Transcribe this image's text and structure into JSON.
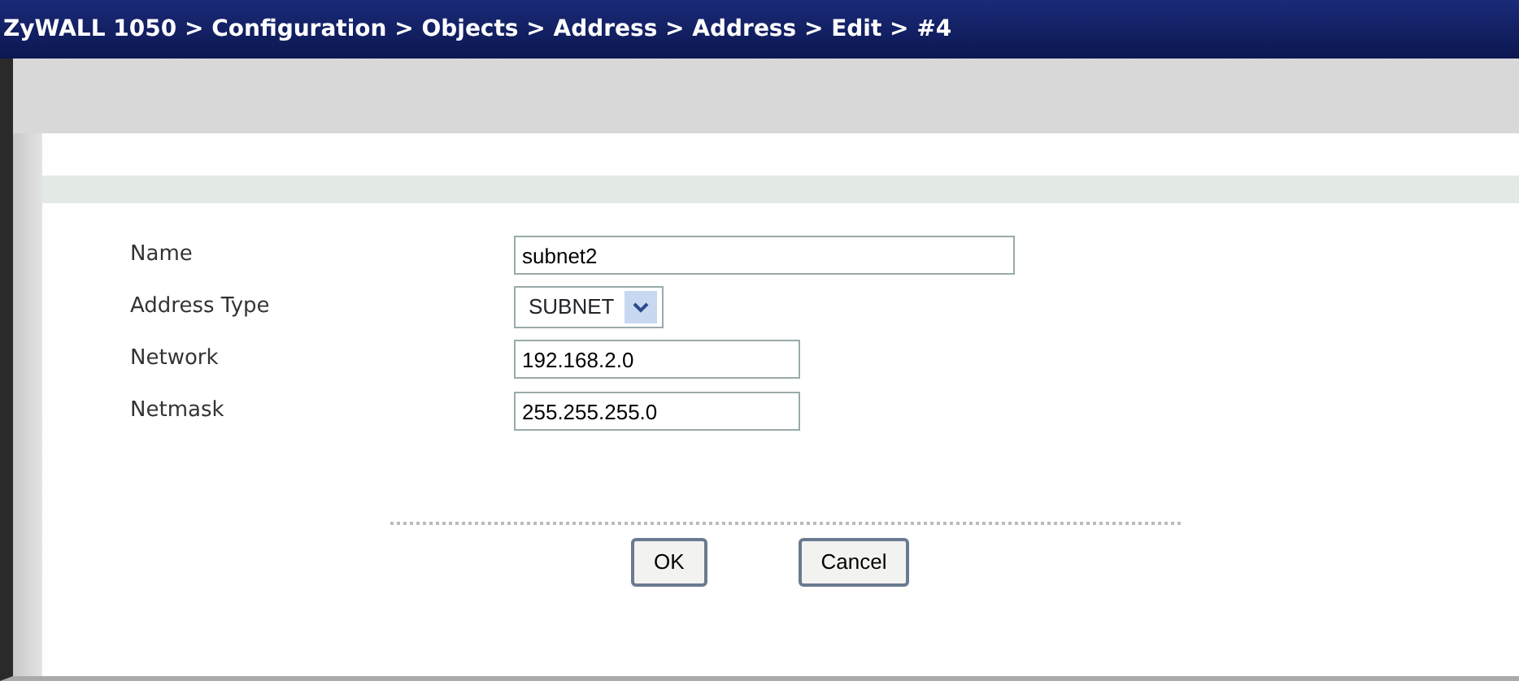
{
  "window": {
    "title": "ZyWALL 1050 > Configuration > Objects > Address > Address > Edit > #4"
  },
  "fields": [
    {
      "label": "Name",
      "kind": "text",
      "value": "subnet2"
    },
    {
      "label": "Address Type",
      "kind": "select",
      "value": "SUBNET"
    },
    {
      "label": "Network",
      "kind": "text",
      "value": "192.168.2.0"
    },
    {
      "label": "Netmask",
      "kind": "text",
      "value": "255.255.255.0"
    }
  ],
  "buttons": [
    "OK",
    "Cancel"
  ]
}
